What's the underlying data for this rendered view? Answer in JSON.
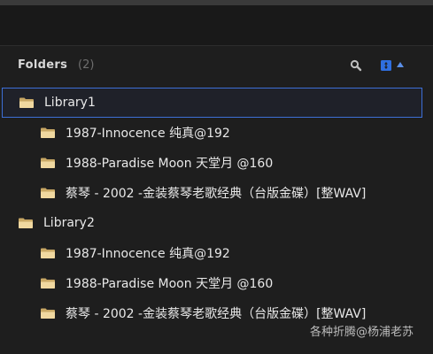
{
  "panel": {
    "title": "Folders",
    "count": "(2)"
  },
  "colors": {
    "accent": "#3d6fd6",
    "folder_fill": "#f0d8a0",
    "background": "#1e1e1e"
  },
  "tree": {
    "libraries": [
      {
        "label": "Library1",
        "selected": true,
        "children": [
          {
            "label": "1987-Innocence 纯真@192"
          },
          {
            "label": "1988-Paradise Moon 天堂月 @160"
          },
          {
            "label": "蔡琴 - 2002 -金装蔡琴老歌经典（台版金碟）[整WAV]"
          }
        ]
      },
      {
        "label": "Library2",
        "selected": false,
        "children": [
          {
            "label": "1987-Innocence 纯真@192"
          },
          {
            "label": "1988-Paradise Moon 天堂月 @160"
          },
          {
            "label": "蔡琴 - 2002 -金装蔡琴老歌经典（台版金碟）[整WAV]"
          }
        ]
      }
    ]
  },
  "watermark": "各种折腾@杨浦老苏"
}
